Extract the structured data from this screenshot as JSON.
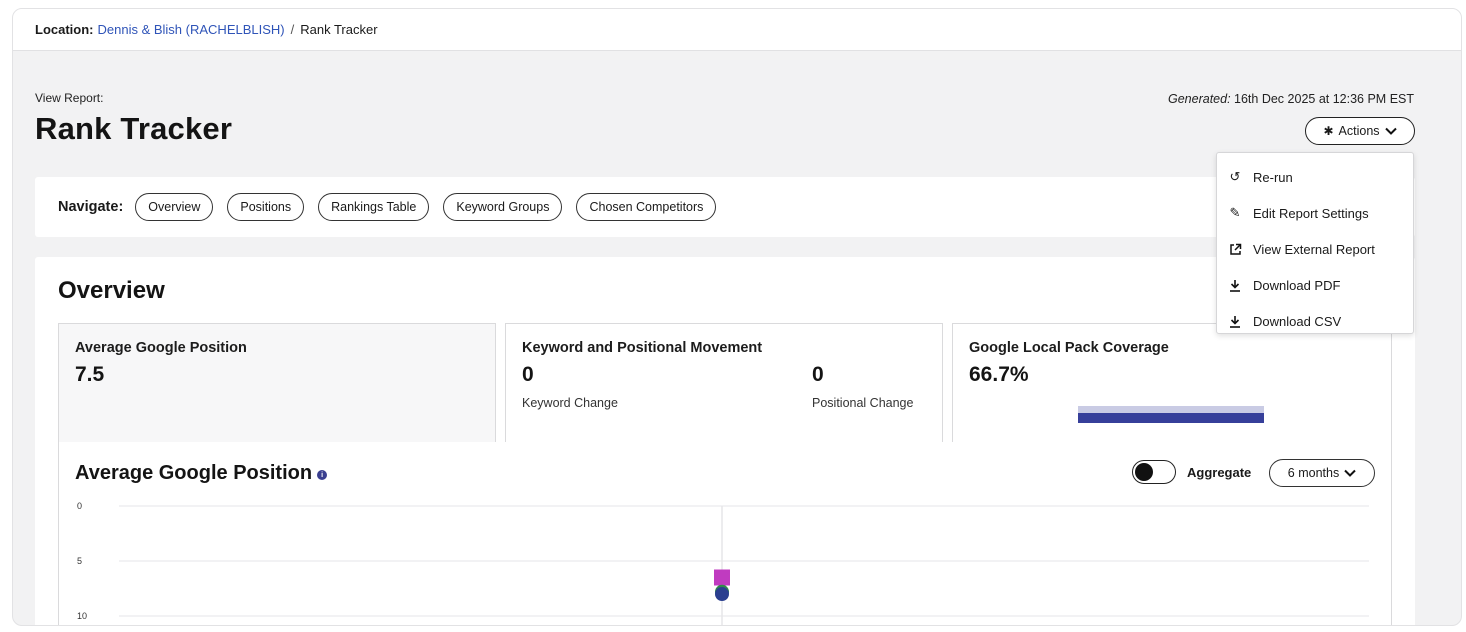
{
  "breadcrumb": {
    "location_label": "Location:",
    "location_name": "Dennis & Blish (RACHELBLISH)",
    "separator": "/",
    "current": "Rank Tracker"
  },
  "header": {
    "view_label": "View Report:",
    "title": "Rank Tracker",
    "generated_label": "Generated:",
    "generated_value": "16th Dec 2025 at 12:36 PM EST",
    "actions_label": "Actions"
  },
  "actions_menu": [
    {
      "label": "Re-run",
      "icon": "rerun-icon"
    },
    {
      "label": "Edit Report Settings",
      "icon": "pencil-icon"
    },
    {
      "label": "View External Report",
      "icon": "external-link-icon"
    },
    {
      "label": "Download PDF",
      "icon": "download-icon"
    },
    {
      "label": "Download CSV",
      "icon": "download-icon"
    }
  ],
  "navigate": {
    "label": "Navigate:",
    "items": [
      "Overview",
      "Positions",
      "Rankings Table",
      "Keyword Groups",
      "Chosen Competitors"
    ]
  },
  "overview": {
    "title": "Overview",
    "avg_position": {
      "title": "Average Google Position",
      "value": "7.5"
    },
    "movement": {
      "title": "Keyword and Positional Movement",
      "keyword_value": "0",
      "keyword_label": "Keyword Change",
      "positional_value": "0",
      "positional_label": "Positional Change"
    },
    "local_pack": {
      "title": "Google Local Pack Coverage",
      "value": "66.7%",
      "coverage_fraction": 0.667
    }
  },
  "avg_chart_section": {
    "title": "Average Google Position",
    "aggregate_label": "Aggregate",
    "aggregate_on": false,
    "range_label": "6 months"
  },
  "colors": {
    "link": "#2f54b8",
    "bar_dark": "#363f9a",
    "bar_light": "#c9cbe4",
    "marker_magenta": "#c03bc0",
    "marker_green": "#2f8a4a",
    "marker_blue": "#2a3f8f"
  },
  "chart_data": {
    "type": "scatter",
    "title": "Average Google Position",
    "xlabel": "",
    "ylabel": "",
    "yticks": [
      "0",
      "5",
      "10"
    ],
    "ylim": [
      0,
      10
    ],
    "y_inverted": true,
    "grid": true,
    "points": [
      {
        "marker": "square",
        "color": "#c03bc0",
        "y": 6.5
      },
      {
        "marker": "circle",
        "color": "#2f8a4a",
        "y": 7.8
      },
      {
        "marker": "circle",
        "color": "#2a3f8f",
        "y": 8.0
      }
    ]
  }
}
